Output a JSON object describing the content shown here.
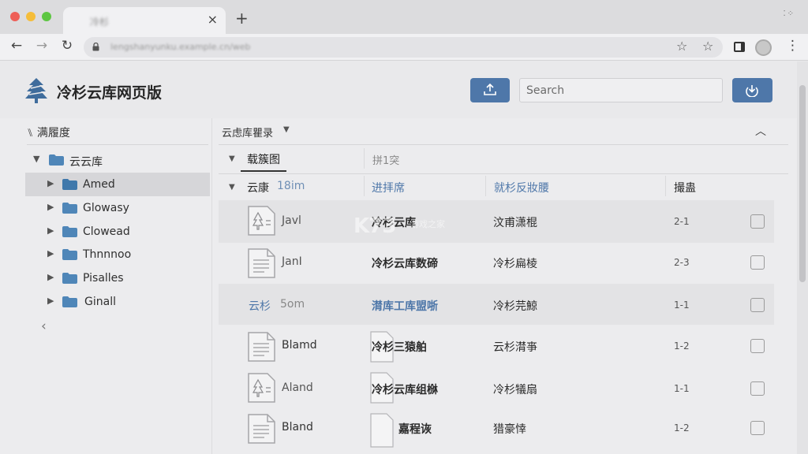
{
  "browser": {
    "tab_title": "冷杉",
    "url": "lengshanyunku.example.cn/web",
    "colors": {
      "close": "#ee5f57",
      "minimize": "#f5bd3a",
      "zoom": "#5dc642"
    }
  },
  "app": {
    "title": "冷杉云库网页版",
    "accent_color": "#4e77a9",
    "search_placeholder": "Search"
  },
  "sidebar": {
    "header": "满履度",
    "root": "云云库",
    "items": [
      {
        "label": "Amed"
      },
      {
        "label": "Glowasy"
      },
      {
        "label": "Clowead"
      },
      {
        "label": "Thnnnoo"
      },
      {
        "label": "Pisalles"
      },
      {
        "label": "Ginall"
      }
    ]
  },
  "main": {
    "breadcrumb": "云虑库瞿录",
    "tabs": [
      "载簇图",
      "拼1突"
    ],
    "group_label": "云康",
    "group_size": "18im",
    "columns": [
      "进拝席",
      "就杉反妝腰",
      "撮蛊"
    ],
    "rows": [
      {
        "name": "Javl",
        "col2": "冷杉云库",
        "col3": "汶甫潇棍",
        "col4": "2-1",
        "icon": "tree"
      },
      {
        "name": "JanI",
        "col2": "冷杉云库数碲",
        "col3": "冷杉扁棱",
        "col4": "2-3",
        "icon": "doc"
      },
      {
        "name": "云杉",
        "size": "5om",
        "col2": "潸库工库盟哳",
        "col3": "冷杉芫鯨",
        "col4": "1-1",
        "icon": "none"
      },
      {
        "name": "Blamd",
        "col2": "冷杉三猿舶",
        "col3": "云杉潸亊",
        "col4": "1-2",
        "icon": "doc"
      },
      {
        "name": "Aland",
        "col2": "冷杉云库组椕",
        "col3": "冷杉犠扇",
        "col4": "1-1",
        "icon": "tree"
      },
      {
        "name": "Bland",
        "col2": "嘉程诙",
        "col3": "猎豪悻",
        "col4": "1-2",
        "icon": "doc"
      }
    ]
  },
  "watermark": {
    "logo": "K73",
    "text": "游戏之家"
  }
}
